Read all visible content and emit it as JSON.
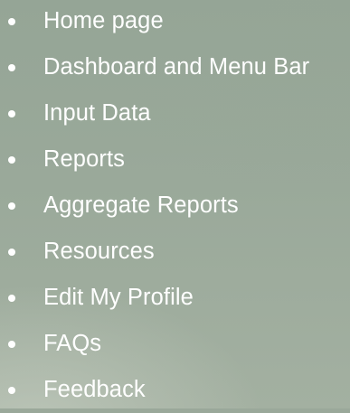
{
  "nav": {
    "items": [
      {
        "label": "Home page"
      },
      {
        "label": "Dashboard and Menu Bar"
      },
      {
        "label": "Input Data"
      },
      {
        "label": "Reports"
      },
      {
        "label": "Aggregate Reports"
      },
      {
        "label": "Resources"
      },
      {
        "label": "Edit My Profile"
      },
      {
        "label": "FAQs"
      },
      {
        "label": "Feedback"
      }
    ]
  },
  "colors": {
    "background": "#9aa89a",
    "text": "#ffffff",
    "bullet": "#ffffff"
  },
  "icons": {
    "bullet": "bullet-icon"
  }
}
